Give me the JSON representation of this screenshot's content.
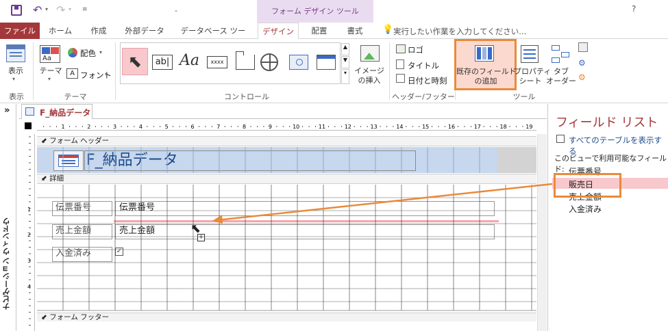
{
  "window": {
    "doc_title": "-",
    "help": "?",
    "contextual_tab": "フォーム デザイン ツール"
  },
  "tabs": [
    "ファイル",
    "ホーム",
    "作成",
    "外部データ",
    "データベース ツール",
    "デザイン",
    "配置",
    "書式"
  ],
  "tell_me": "実行したい作業を入力してください...",
  "ribbon": {
    "view": {
      "label": "表示",
      "group": "表示"
    },
    "themes": {
      "theme": "テーマ",
      "colors": "配色",
      "fonts": "フォント",
      "group": "テーマ"
    },
    "controls": {
      "group": "コントロール",
      "label_sample": "Aa",
      "textbox_sample": "ab|",
      "button_sample": "xxxx",
      "insert_image": "イメージ\nの挿入"
    },
    "header_footer": {
      "logo": "ロゴ",
      "title": "タイトル",
      "datetime": "日付と時刻",
      "group": "ヘッダー/フッター"
    },
    "tools": {
      "add_existing": "既存のフィールド\nの追加",
      "property_sheet": "プロパティ\nシート",
      "tab_order": "タブ\nオーダー",
      "group": "ツール"
    }
  },
  "nav_pane": {
    "label": "ナビゲーション ウィンドウ",
    "toggle": "»"
  },
  "document": {
    "tab": "F_納品データ",
    "header_section": "フォーム ヘッダー",
    "form_title": "F_納品データ",
    "detail_section": "詳細",
    "footer_section": "フォーム フッター",
    "controls": [
      {
        "label": "伝票番号",
        "value": "伝票番号"
      },
      {
        "label": "売上金額",
        "value": "売上金額"
      },
      {
        "label": "入金済み",
        "value": "✓"
      }
    ],
    "ruler_h": [
      "1",
      "2",
      "3",
      "4",
      "5",
      "6",
      "7",
      "8",
      "9",
      "10",
      "11",
      "12",
      "13",
      "14",
      "15",
      "16",
      "17",
      "18",
      "19"
    ],
    "ruler_v": [
      "1",
      "2",
      "3",
      "4"
    ]
  },
  "field_list": {
    "title": "フィールド リスト",
    "show_all": "すべてのテーブルを表示する",
    "available": "このビューで利用可能なフィールド:",
    "fields": [
      "伝票番号",
      "販売日",
      "売上金額",
      "入金済み"
    ]
  },
  "colors": {
    "accent": "#a4373a",
    "contextual": "#eadcf0",
    "highlight": "#e98a3a",
    "selection_pink": "#f8c8cc"
  }
}
